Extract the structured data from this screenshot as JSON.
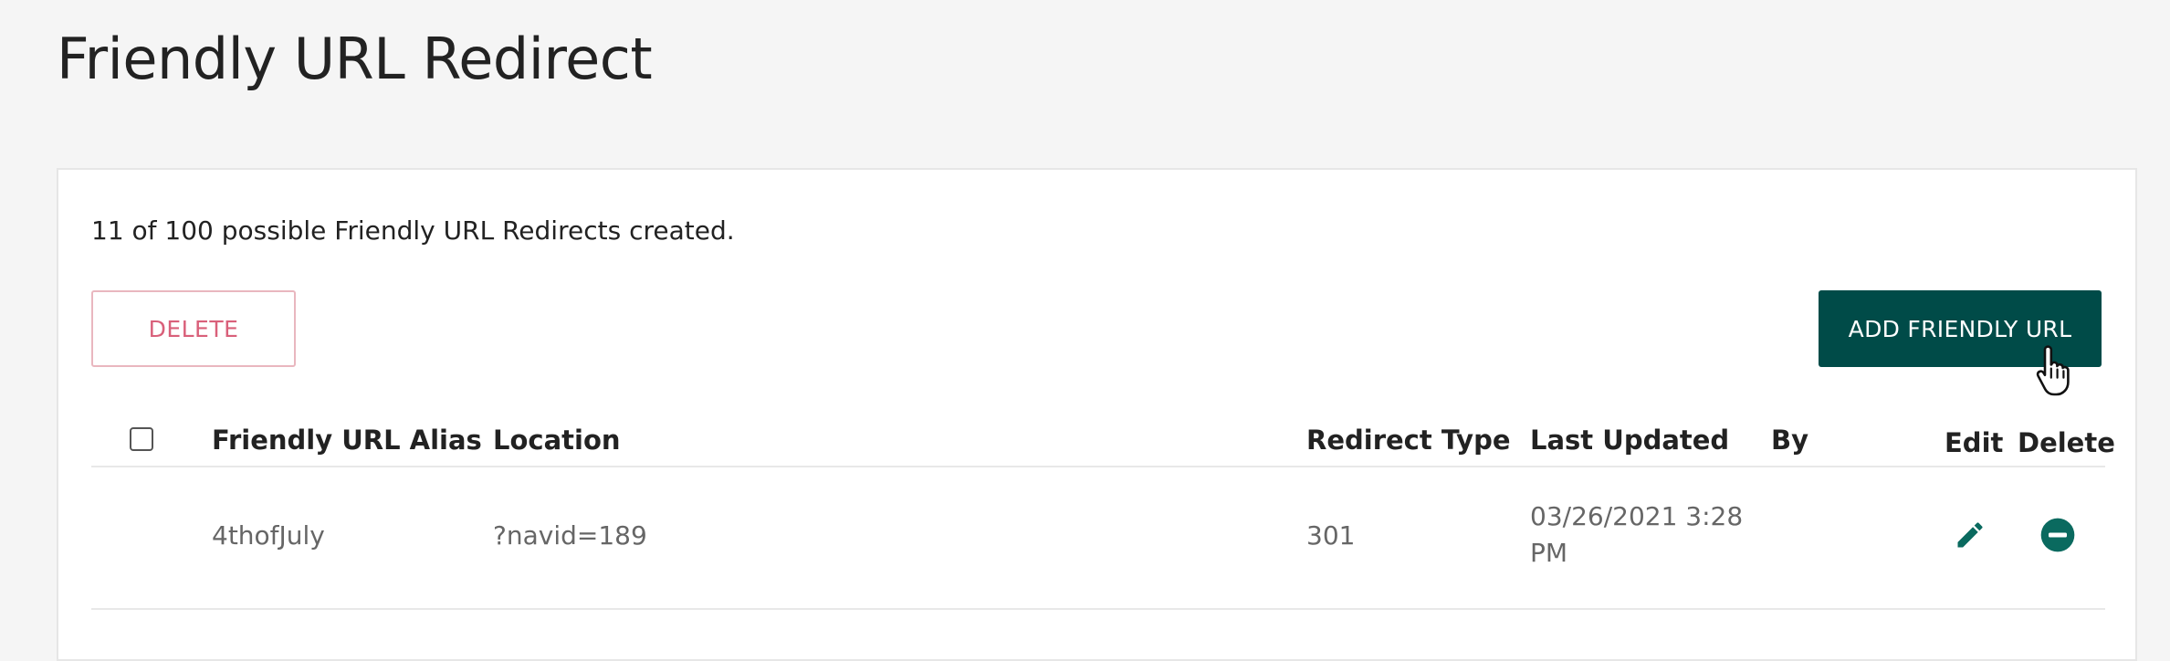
{
  "page": {
    "title": "Friendly URL Redirect"
  },
  "summary": {
    "text": "11 of 100 possible Friendly URL Redirects created."
  },
  "toolbar": {
    "delete_label": "DELETE",
    "add_label": "ADD FRIENDLY URL"
  },
  "table": {
    "columns": {
      "alias": "Friendly URL Alias",
      "location": "Location",
      "redirect_type": "Redirect Type",
      "last_updated": "Last Updated",
      "by": "By",
      "edit": "Edit",
      "delete": "Delete"
    },
    "rows": [
      {
        "alias": "4thofJuly",
        "location": "?navid=189",
        "redirect_type": "301",
        "last_updated": "03/26/2021 3:28 PM",
        "by": ""
      }
    ]
  },
  "icons": {
    "edit": "pencil-icon",
    "delete": "minus-circle-icon",
    "cursor": "hand-pointer-icon"
  },
  "colors": {
    "primary": "#004b48",
    "danger_text": "#d9607a",
    "danger_border": "#e9b7bf",
    "icon": "#0a6a5f"
  }
}
